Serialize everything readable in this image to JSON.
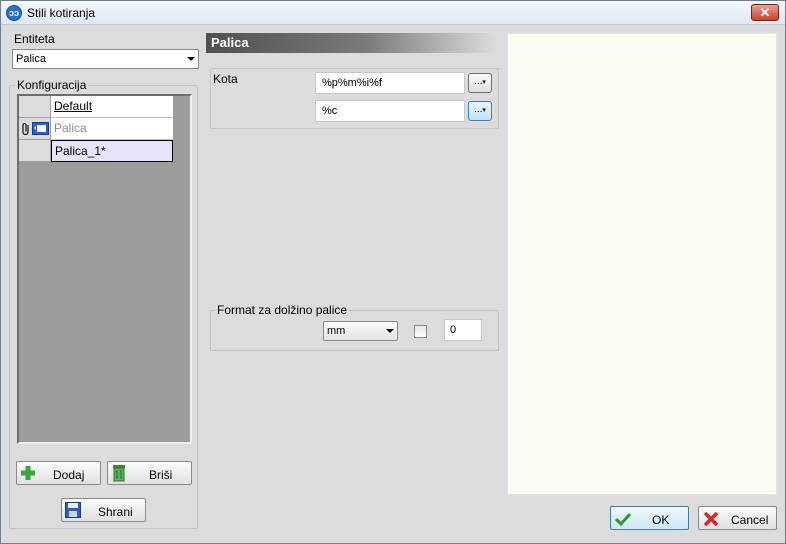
{
  "window": {
    "title": "Stili kotiranja",
    "close_glyph": "✕",
    "icon_letter": "ɔɔ"
  },
  "entity": {
    "label": "Entiteta",
    "selected": "Palica"
  },
  "config": {
    "group_label": "Konfiguracija",
    "items": [
      {
        "label": "Default",
        "state": "default"
      },
      {
        "label": "Palica",
        "state": "disabled"
      },
      {
        "label": "Palica_1*",
        "state": "selected"
      }
    ]
  },
  "buttons": {
    "add": "Dodaj",
    "delete": "Briši",
    "save": "Shrani",
    "ok": "OK",
    "cancel": "Cancel"
  },
  "panel": {
    "header": "Palica",
    "kota_label": "Kota",
    "field1_value": "%p%m%i%f",
    "field2_value": "%c",
    "ellipsis_label": "...",
    "format_group_label": "Format za dolžino palice",
    "unit_selected": "mm",
    "decimal_value": "0"
  },
  "icons": [
    "app-icon",
    "close-icon",
    "chevron-down-icon",
    "paperclip-icon",
    "edit-record-icon",
    "plus-icon",
    "trash-icon",
    "floppy-disk-icon",
    "checkmark-icon",
    "x-icon"
  ],
  "colors": {
    "preview_bg": "#fdfcf1",
    "selected_row": "#e6e3fa",
    "accent_blue": "#3c7fb1"
  }
}
